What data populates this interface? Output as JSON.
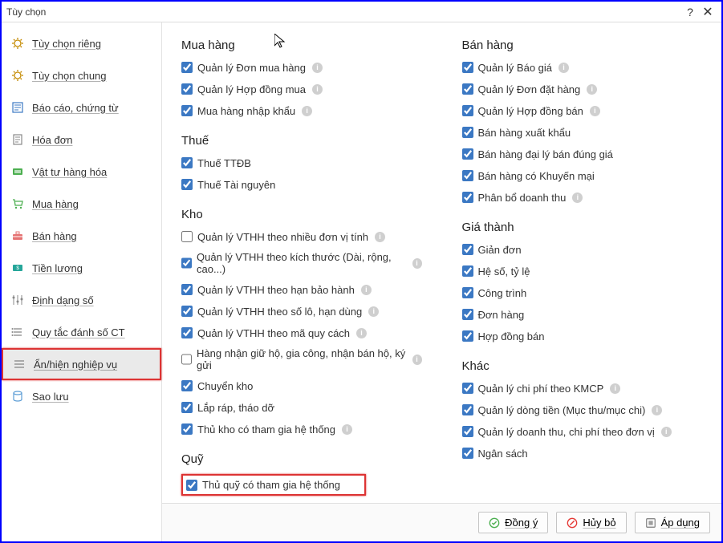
{
  "window": {
    "title": "Tùy chọn"
  },
  "sidebar": {
    "items": [
      {
        "label": "Tùy chọn riêng",
        "active": false
      },
      {
        "label": "Tùy chọn chung",
        "active": false
      },
      {
        "label": "Báo cáo, chứng từ",
        "active": false
      },
      {
        "label": "Hóa đơn",
        "active": false
      },
      {
        "label": "Vật tư hàng hóa",
        "active": false
      },
      {
        "label": "Mua hàng",
        "active": false
      },
      {
        "label": "Bán hàng",
        "active": false
      },
      {
        "label": "Tiền lương",
        "active": false
      },
      {
        "label": "Định dạng số",
        "active": false
      },
      {
        "label": "Quy tắc đánh số CT",
        "active": false
      },
      {
        "label": "Ẩn/hiện nghiệp vụ",
        "active": true,
        "highlight": true
      },
      {
        "label": "Sao lưu",
        "active": false
      }
    ]
  },
  "sections_left": [
    {
      "title": "Mua hàng",
      "items": [
        {
          "label": "Quản lý Đơn mua hàng",
          "checked": true,
          "info": true
        },
        {
          "label": "Quản lý Hợp đồng mua",
          "checked": true,
          "info": true
        },
        {
          "label": "Mua hàng nhập khẩu",
          "checked": true,
          "info": true
        }
      ]
    },
    {
      "title": "Thuế",
      "items": [
        {
          "label": "Thuế TTĐB",
          "checked": true,
          "info": false
        },
        {
          "label": "Thuế Tài nguyên",
          "checked": true,
          "info": false
        }
      ]
    },
    {
      "title": "Kho",
      "items": [
        {
          "label": "Quản lý VTHH theo nhiều đơn vị tính",
          "checked": false,
          "info": true
        },
        {
          "label": "Quản lý VTHH theo kích thước (Dài, rộng, cao...)",
          "checked": true,
          "info": true
        },
        {
          "label": "Quản lý VTHH theo hạn bảo hành",
          "checked": true,
          "info": true
        },
        {
          "label": "Quản lý VTHH theo số lô, hạn dùng",
          "checked": true,
          "info": true
        },
        {
          "label": "Quản lý VTHH theo mã quy cách",
          "checked": true,
          "info": true
        },
        {
          "label": "Hàng nhận giữ hộ, gia công, nhận bán hộ, ký gửi",
          "checked": false,
          "info": true
        },
        {
          "label": "Chuyển kho",
          "checked": true,
          "info": false
        },
        {
          "label": "Lắp ráp, tháo dỡ",
          "checked": true,
          "info": false
        },
        {
          "label": "Thủ kho có tham gia hệ thống",
          "checked": true,
          "info": true
        }
      ]
    },
    {
      "title": "Quỹ",
      "items": [
        {
          "label": "Thủ quỹ có tham gia hệ thống",
          "checked": true,
          "info": false,
          "highlight": true
        }
      ]
    }
  ],
  "sections_right": [
    {
      "title": "Bán hàng",
      "items": [
        {
          "label": "Quản lý Báo giá",
          "checked": true,
          "info": true
        },
        {
          "label": "Quản lý Đơn đặt hàng",
          "checked": true,
          "info": true
        },
        {
          "label": "Quản lý Hợp đồng bán",
          "checked": true,
          "info": true
        },
        {
          "label": "Bán hàng xuất khẩu",
          "checked": true,
          "info": false
        },
        {
          "label": "Bán hàng đại lý bán đúng giá",
          "checked": true,
          "info": false
        },
        {
          "label": "Bán hàng có Khuyến mại",
          "checked": true,
          "info": false
        },
        {
          "label": "Phân bổ doanh thu",
          "checked": true,
          "info": true
        }
      ]
    },
    {
      "title": "Giá thành",
      "items": [
        {
          "label": "Giản đơn",
          "checked": true,
          "info": false
        },
        {
          "label": "Hệ số, tỷ lệ",
          "checked": true,
          "info": false
        },
        {
          "label": "Công trình",
          "checked": true,
          "info": false
        },
        {
          "label": "Đơn hàng",
          "checked": true,
          "info": false
        },
        {
          "label": "Hợp đồng bán",
          "checked": true,
          "info": false
        }
      ]
    },
    {
      "title": "Khác",
      "items": [
        {
          "label": "Quản lý chi phí theo KMCP",
          "checked": true,
          "info": true
        },
        {
          "label": "Quản lý dòng tiền (Mục thu/mục chi)",
          "checked": true,
          "info": true
        },
        {
          "label": "Quản lý doanh thu, chi phí theo đơn vị",
          "checked": true,
          "info": true
        },
        {
          "label": "Ngân sách",
          "checked": true,
          "info": false
        }
      ]
    }
  ],
  "footer": {
    "ok": "Đồng ý",
    "cancel": "Hủy bỏ",
    "apply": "Áp dụng"
  }
}
